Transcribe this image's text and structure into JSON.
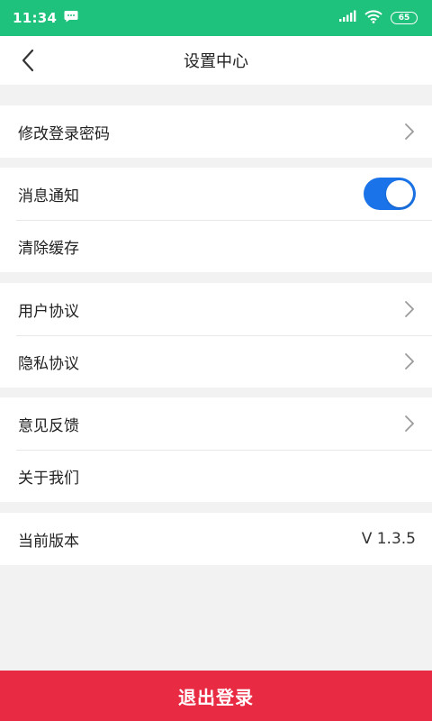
{
  "status_bar": {
    "time": "11:34",
    "battery": "65",
    "color": "#1fc27c",
    "icons": [
      "message-icon",
      "signal-icon",
      "wifi-icon",
      "battery-icon"
    ]
  },
  "nav": {
    "title": "设置中心",
    "back_icon": "chevron-left-icon"
  },
  "groups": [
    {
      "items": [
        {
          "label": "修改登录密码",
          "trailing": "chevron"
        }
      ]
    },
    {
      "items": [
        {
          "label": "消息通知",
          "trailing": "toggle",
          "toggle_on": true
        },
        {
          "label": "清除缓存",
          "trailing": "none"
        }
      ]
    },
    {
      "items": [
        {
          "label": "用户协议",
          "trailing": "chevron"
        },
        {
          "label": "隐私协议",
          "trailing": "chevron"
        }
      ]
    },
    {
      "items": [
        {
          "label": "意见反馈",
          "trailing": "chevron"
        },
        {
          "label": "关于我们",
          "trailing": "none"
        }
      ]
    },
    {
      "items": [
        {
          "label": "当前版本",
          "value": "V 1.3.5"
        }
      ]
    }
  ],
  "logout": {
    "label": "退出登录",
    "color": "#e82a43"
  },
  "accent": "#1a73e8"
}
